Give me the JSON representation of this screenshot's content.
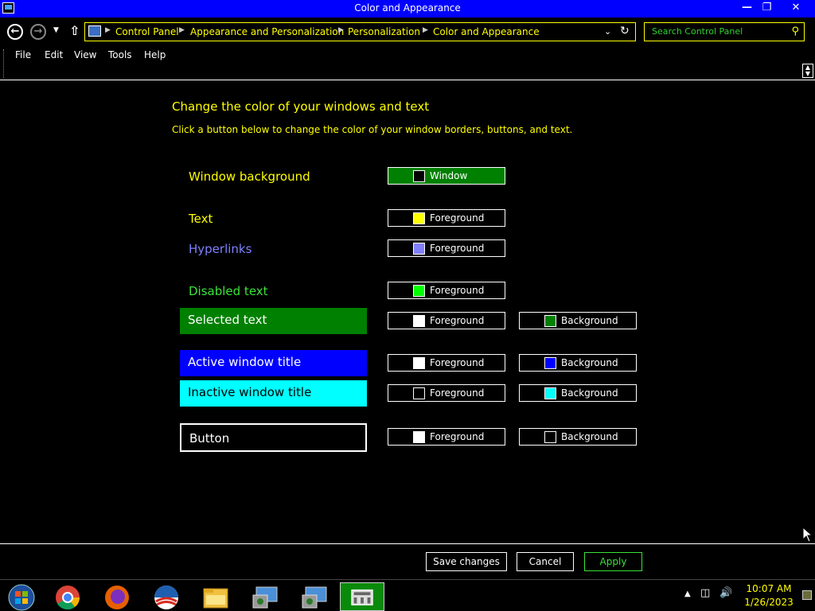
{
  "window": {
    "title": "Color and Appearance"
  },
  "address_bar": {
    "crumbs": [
      "Control Panel",
      "Appearance and Personalization",
      "Personalization",
      "Color and Appearance"
    ],
    "search_placeholder": "Search Control Panel"
  },
  "menu": {
    "items": [
      "File",
      "Edit",
      "View",
      "Tools",
      "Help"
    ]
  },
  "content": {
    "heading": "Change the color of your windows and text",
    "description": "Click a button below to change the color of your window borders, buttons, and text.",
    "rows": [
      {
        "label": "Window background",
        "label_color": "#ffff00",
        "label_bg": null,
        "buttons": [
          {
            "text": "Window",
            "swatch": "#000000",
            "bg": "#008000"
          }
        ]
      },
      {
        "label": "Text",
        "label_color": "#ffff00",
        "label_bg": null,
        "buttons": [
          {
            "text": "Foreground",
            "swatch": "#ffff00"
          }
        ]
      },
      {
        "label": "Hyperlinks",
        "label_color": "#8080ff",
        "label_bg": null,
        "buttons": [
          {
            "text": "Foreground",
            "swatch": "#8080ff"
          }
        ]
      },
      {
        "label": "Disabled text",
        "label_color": "#3ae33a",
        "label_bg": null,
        "buttons": [
          {
            "text": "Foreground",
            "swatch": "#00ff00"
          }
        ]
      },
      {
        "label": "Selected text",
        "label_color": "#ffffff",
        "label_bg": "#008000",
        "buttons": [
          {
            "text": "Foreground",
            "swatch": "#ffffff"
          },
          {
            "text": "Background",
            "swatch": "#008000"
          }
        ]
      },
      {
        "label": "Active window title",
        "label_color": "#ffffff",
        "label_bg": "#0000ff",
        "buttons": [
          {
            "text": "Foreground",
            "swatch": "#ffffff"
          },
          {
            "text": "Background",
            "swatch": "#0000ff"
          }
        ]
      },
      {
        "label": "Inactive window title",
        "label_color": "#000000",
        "label_bg": "#00ffff",
        "buttons": [
          {
            "text": "Foreground",
            "swatch": "#000000"
          },
          {
            "text": "Background",
            "swatch": "#00ffff"
          }
        ]
      },
      {
        "label": "Button",
        "label_color": "#ffffff",
        "label_bg": "#000000",
        "buttons": [
          {
            "text": "Foreground",
            "swatch": "#ffffff"
          },
          {
            "text": "Background",
            "swatch": "#000000"
          }
        ]
      }
    ]
  },
  "actions": {
    "save": "Save changes",
    "cancel": "Cancel",
    "apply": "Apply",
    "apply_color": "#3ae33a"
  },
  "taskbar": {
    "apps": [
      "start-orb-icon",
      "chrome-icon",
      "firefox-icon",
      "obama-logo-icon",
      "file-explorer-icon",
      "control-panel-icon",
      "control-panel-icon",
      "color-appearance-icon"
    ],
    "time": "10:07 AM",
    "date": "1/26/2023"
  }
}
